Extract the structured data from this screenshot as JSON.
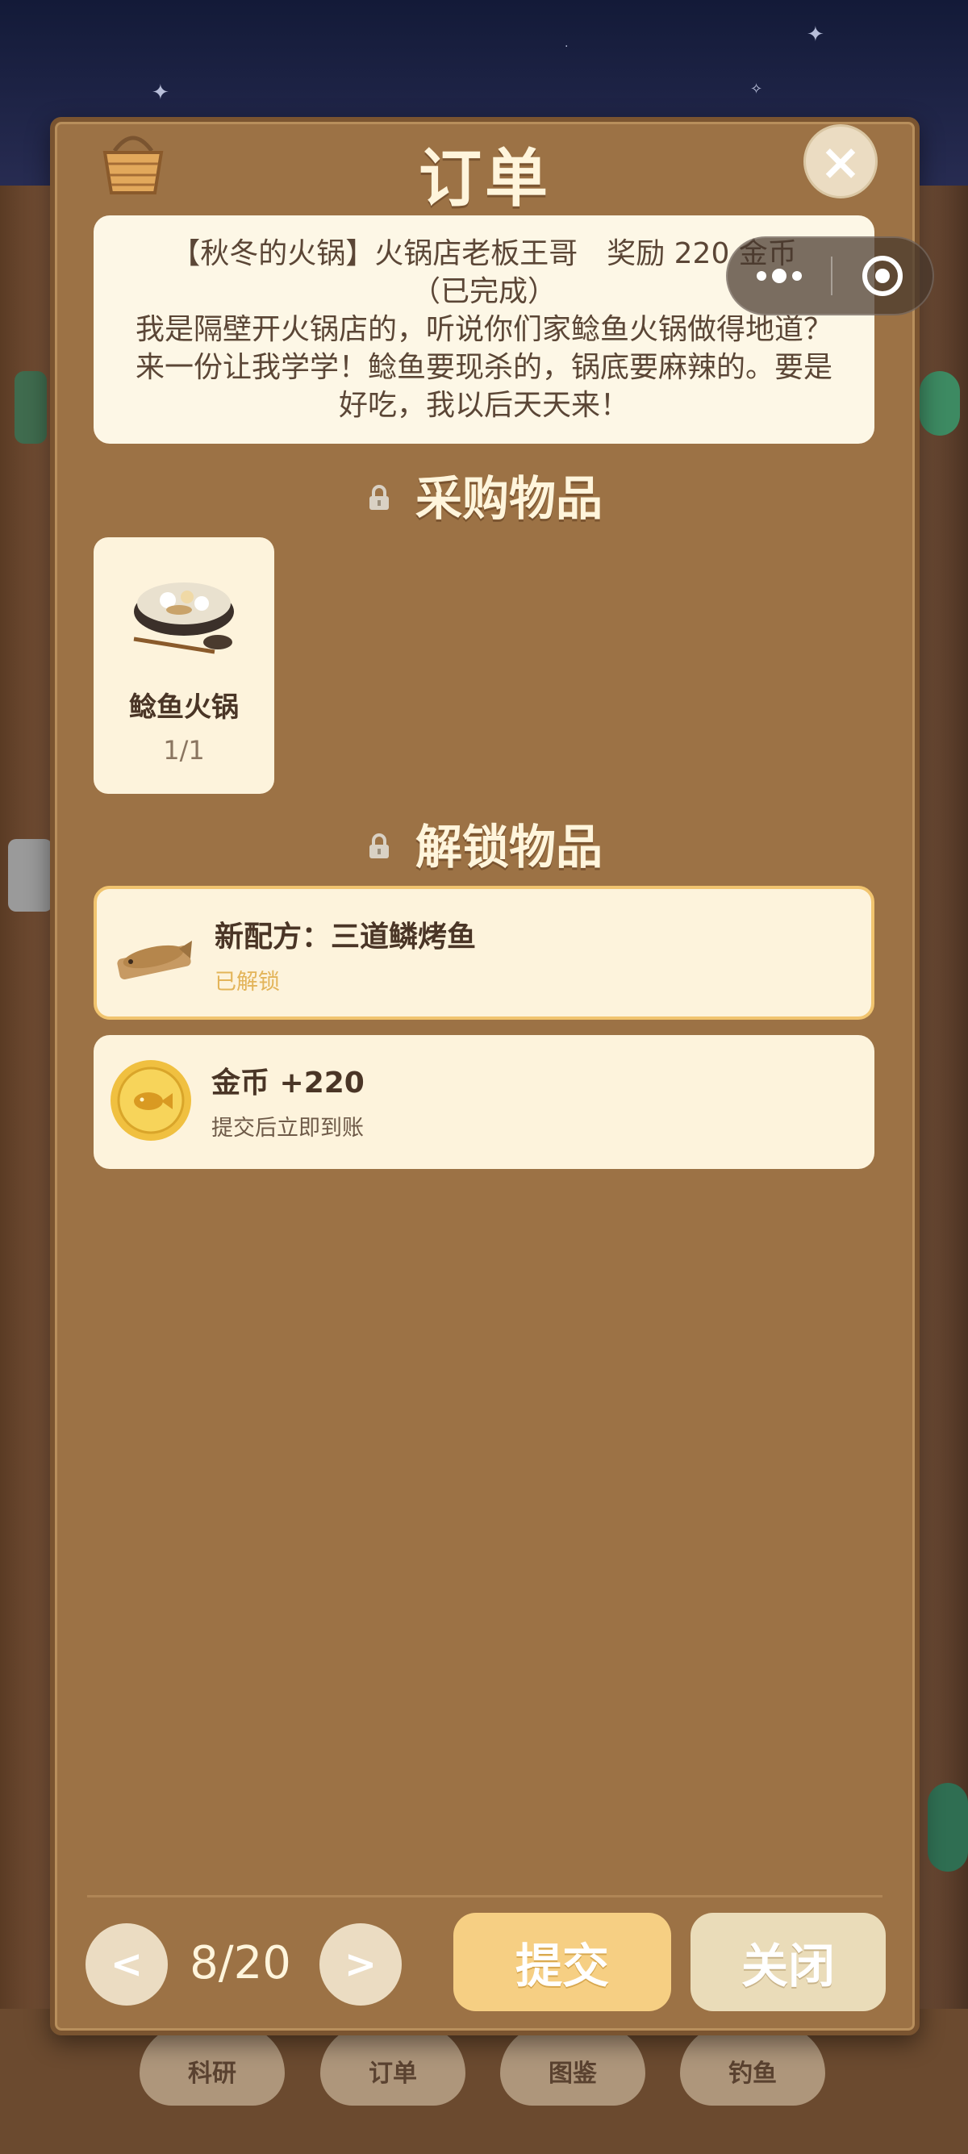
{
  "panel": {
    "title": "订单",
    "close_icon": "×"
  },
  "order": {
    "header": "【秋冬的火锅】火锅店老板王哥　奖励 220 金币",
    "status": "（已完成）",
    "description": "我是隔壁开火锅店的，听说你们家鲶鱼火锅做得地道？来一份让我学学！鲶鱼要现杀的，锅底要麻辣的。要是好吃，我以后天天来！"
  },
  "purchase": {
    "heading": "采购物品",
    "items": [
      {
        "name": "鲶鱼火锅",
        "count": "1/1",
        "icon": "catfish-hotpot-icon"
      }
    ]
  },
  "unlock": {
    "heading": "解锁物品",
    "rewards": [
      {
        "title": "新配方：三道鳞烤鱼",
        "subtitle": "已解锁",
        "icon": "grilled-fish-icon"
      },
      {
        "title": "金币 +220",
        "subtitle": "提交后立即到账",
        "icon": "gold-coin-icon"
      }
    ]
  },
  "pager": {
    "prev": "<",
    "next": ">",
    "page": "8/20"
  },
  "actions": {
    "submit": "提交",
    "close": "关闭"
  },
  "bottom_nav": {
    "items": [
      "科研",
      "订单",
      "图鉴",
      "钓鱼"
    ]
  },
  "colors": {
    "panel_bg": "#9c7245",
    "card_bg": "#fdf3dc",
    "accent_gold": "#f6cf83",
    "unlocked_text": "#e3b459"
  }
}
